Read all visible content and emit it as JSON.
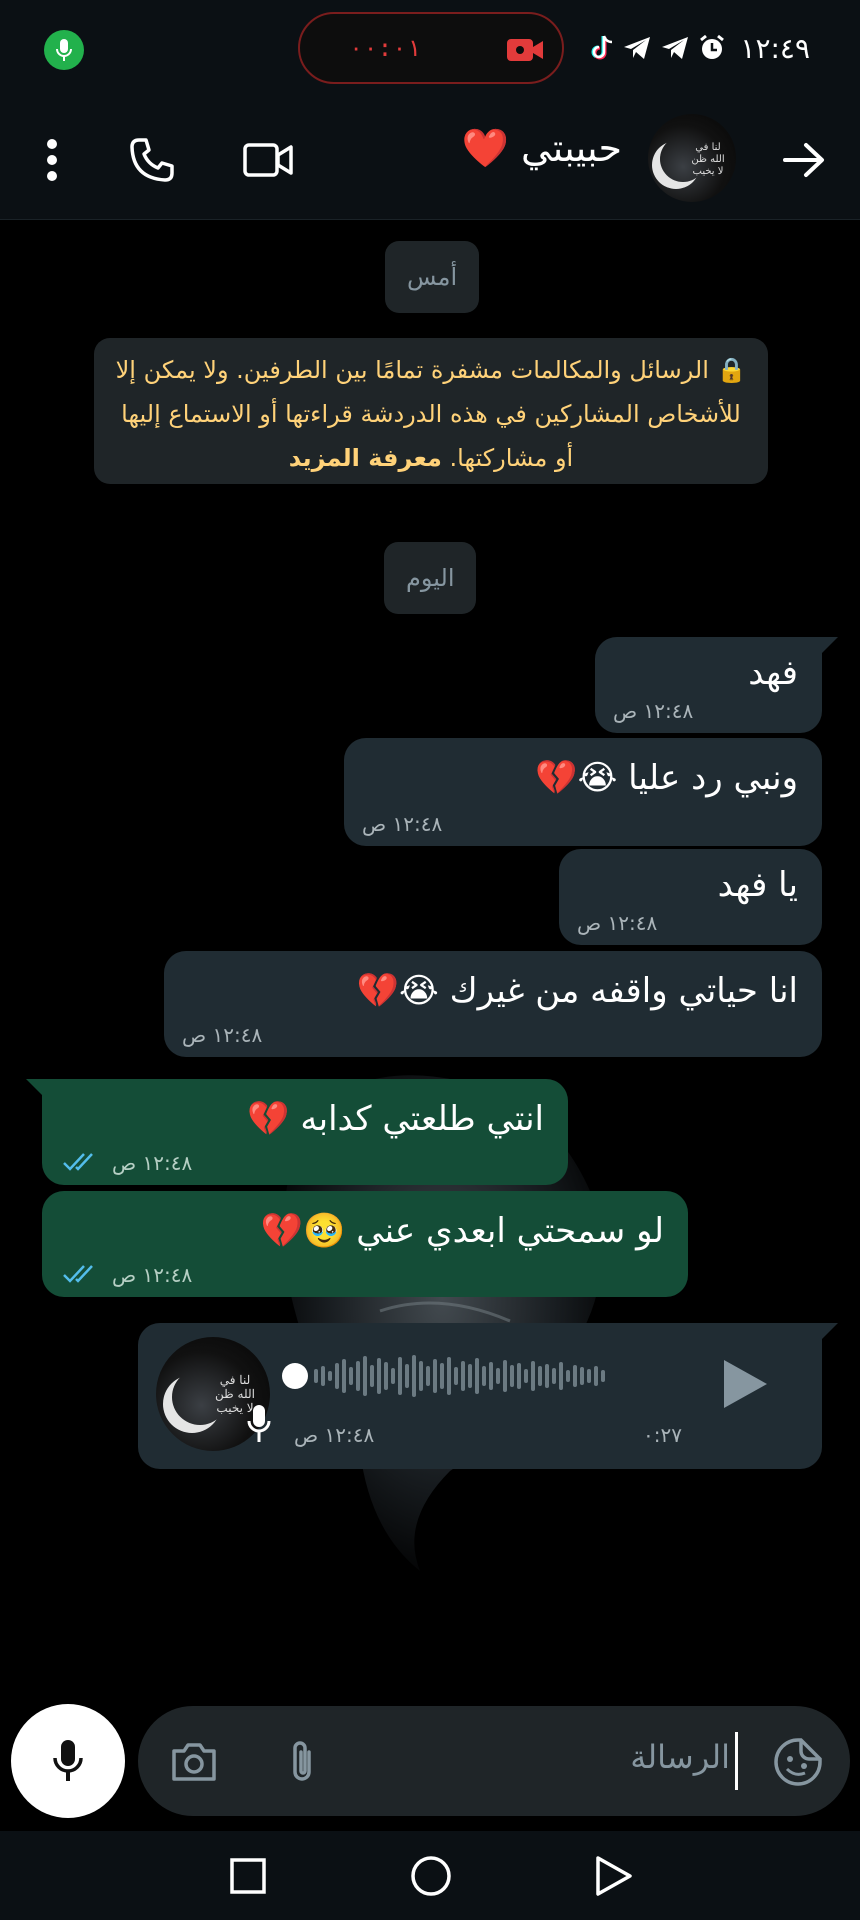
{
  "status_bar": {
    "time": "١٢:٤٩",
    "recording_timer": "٠٠:٠١",
    "colors": {
      "mic_dot": "#22b14c",
      "recording": "#e23b3b"
    }
  },
  "header": {
    "contact_name": "حبيبتي ❤️",
    "icons": [
      "back-arrow-icon",
      "avatar",
      "video-call-icon",
      "voice-call-icon",
      "more-vert-icon"
    ]
  },
  "chat": {
    "date_yesterday": "أمس",
    "encryption_notice": "🔒 الرسائل والمكالمات مشفرة تمامًا بين الطرفين. ولا يمكن إلا للأشخاص المشاركين في هذه الدردشة قراءتها أو الاستماع إليها أو مشاركتها.",
    "learn_more": "معرفة المزيد",
    "date_today": "اليوم",
    "messages": [
      {
        "direction": "in",
        "text": "فهد",
        "time": "١٢:٤٨ ص"
      },
      {
        "direction": "in",
        "text": "ونبي رد عليا 😭💔",
        "time": "١٢:٤٨ ص"
      },
      {
        "direction": "in",
        "text": "يا فهد",
        "time": "١٢:٤٨ ص"
      },
      {
        "direction": "in",
        "text": "انا حياتي واقفه من غيرك 😭💔",
        "time": "١٢:٤٨ ص"
      },
      {
        "direction": "out",
        "text": "انتي طلعتي كدابه 💔",
        "time": "١٢:٤٨ ص",
        "status": "read"
      },
      {
        "direction": "out",
        "text": "لو سمحتي ابعدي عني 🥹💔",
        "time": "١٢:٤٨ ص",
        "status": "read"
      }
    ],
    "voice_note": {
      "direction": "in",
      "duration": "٠:٢٧",
      "time": "١٢:٤٨ ص",
      "progress": 0
    },
    "colors": {
      "incoming": "#202c33",
      "outgoing": "#144d37",
      "read_ticks": "#53bdeb",
      "notice_text": "#ffd279"
    }
  },
  "composer": {
    "placeholder": "الرسالة",
    "icons": [
      "sticker-icon",
      "attach-icon",
      "camera-icon",
      "mic-icon"
    ]
  },
  "nav": {
    "icons": [
      "recents-icon",
      "home-icon",
      "back-icon"
    ]
  }
}
